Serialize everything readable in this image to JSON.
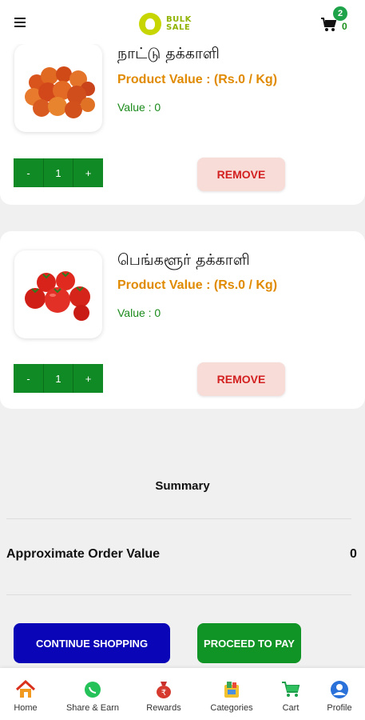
{
  "header": {
    "logo_text_line1": "BULK",
    "logo_text_line2": "SALE",
    "cart_count": "2",
    "cart_total": "0"
  },
  "cart_items": [
    {
      "name": "நாட்டு தக்காளி",
      "product_value": "Product Value : (Rs.0 / Kg)",
      "value_text": "Value :  0",
      "minus": "-",
      "quantity": "1",
      "plus": "+",
      "remove_label": "REMOVE",
      "image_icon": "tomato-pile-icon"
    },
    {
      "name": "பெங்களூர் தக்காளி",
      "product_value": "Product Value : (Rs.0 / Kg)",
      "value_text": "Value :  0",
      "minus": "-",
      "quantity": "1",
      "plus": "+",
      "remove_label": "REMOVE",
      "image_icon": "tomato-cluster-icon"
    }
  ],
  "summary": {
    "title": "Summary",
    "order_label": "Approximate Order Value",
    "order_value": "0",
    "continue_label": "CONTINUE SHOPPING",
    "proceed_label": "PROCEED TO PAY"
  },
  "bottom_nav": [
    {
      "label": "Home",
      "icon": "home-icon"
    },
    {
      "label": "Share & Earn",
      "icon": "whatsapp-icon"
    },
    {
      "label": "Rewards",
      "icon": "rewards-icon"
    },
    {
      "label": "Categories",
      "icon": "categories-icon"
    },
    {
      "label": "Cart",
      "icon": "cart-icon"
    },
    {
      "label": "Profile",
      "icon": "profile-icon"
    }
  ],
  "colors": {
    "accent_green": "#0f8a24",
    "product_value_orange": "#e08a00",
    "continue_blue": "#0a06b8",
    "remove_red": "#d32020",
    "remove_bg": "#f7dcd7"
  }
}
